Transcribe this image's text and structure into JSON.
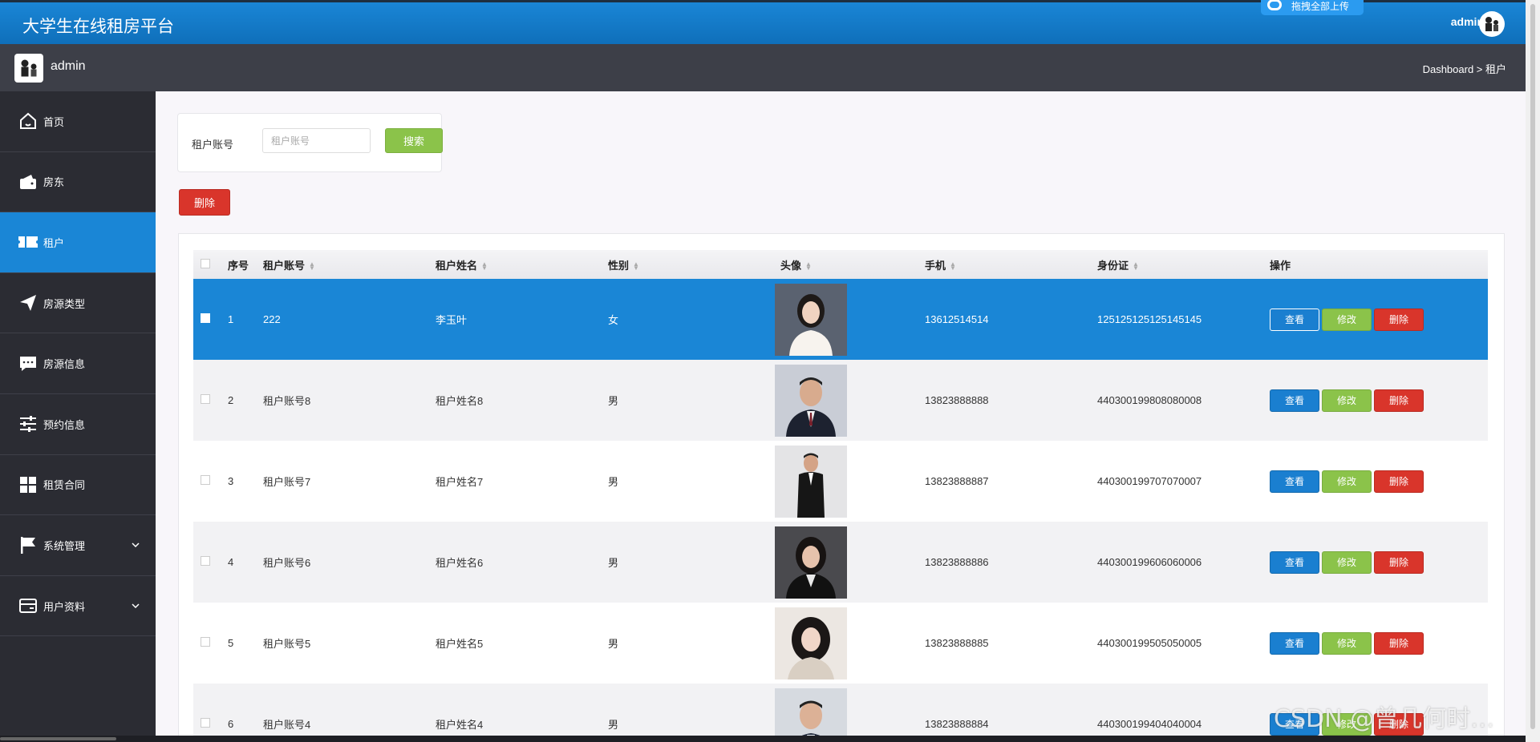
{
  "app": {
    "title": "大学生在线租房平台",
    "upload_chip": "拖拽全部上传"
  },
  "topbar": {
    "username": "admin"
  },
  "subbar": {
    "username": "admin",
    "breadcrumb": "Dashboard > 租户"
  },
  "sidebar": {
    "items": [
      {
        "label": "首页",
        "icon": "home-icon"
      },
      {
        "label": "房东",
        "icon": "wallet-icon"
      },
      {
        "label": "租户",
        "icon": "ticket-icon",
        "active": true
      },
      {
        "label": "房源类型",
        "icon": "paper-plane-icon"
      },
      {
        "label": "房源信息",
        "icon": "chat-icon"
      },
      {
        "label": "预约信息",
        "icon": "sliders-icon"
      },
      {
        "label": "租赁合同",
        "icon": "grid-icon"
      },
      {
        "label": "系统管理",
        "icon": "flag-icon",
        "expandable": true
      },
      {
        "label": "用户资料",
        "icon": "card-icon",
        "expandable": true
      }
    ]
  },
  "search": {
    "label": "租户账号",
    "placeholder": "租户账号",
    "button": "搜索"
  },
  "toolbar": {
    "delete_label": "删除"
  },
  "table": {
    "headers": {
      "index": "序号",
      "account": "租户账号",
      "name": "租户姓名",
      "gender": "性别",
      "avatar": "头像",
      "phone": "手机",
      "idcard": "身份证",
      "ops": "操作"
    },
    "actions": {
      "view": "查看",
      "edit": "修改",
      "delete": "删除"
    },
    "rows": [
      {
        "index": "1",
        "account": "222",
        "name": "李玉叶",
        "gender": "女",
        "phone": "13612514514",
        "idcard": "125125125125145145"
      },
      {
        "index": "2",
        "account": "租户账号8",
        "name": "租户姓名8",
        "gender": "男",
        "phone": "13823888888",
        "idcard": "440300199808080008"
      },
      {
        "index": "3",
        "account": "租户账号7",
        "name": "租户姓名7",
        "gender": "男",
        "phone": "13823888887",
        "idcard": "440300199707070007"
      },
      {
        "index": "4",
        "account": "租户账号6",
        "name": "租户姓名6",
        "gender": "男",
        "phone": "13823888886",
        "idcard": "440300199606060006"
      },
      {
        "index": "5",
        "account": "租户账号5",
        "name": "租户姓名5",
        "gender": "男",
        "phone": "13823888885",
        "idcard": "440300199505050005"
      },
      {
        "index": "6",
        "account": "租户账号4",
        "name": "租户姓名4",
        "gender": "男",
        "phone": "13823888884",
        "idcard": "440300199404040004"
      }
    ]
  },
  "watermark": "CSDN @曾几何时…"
}
